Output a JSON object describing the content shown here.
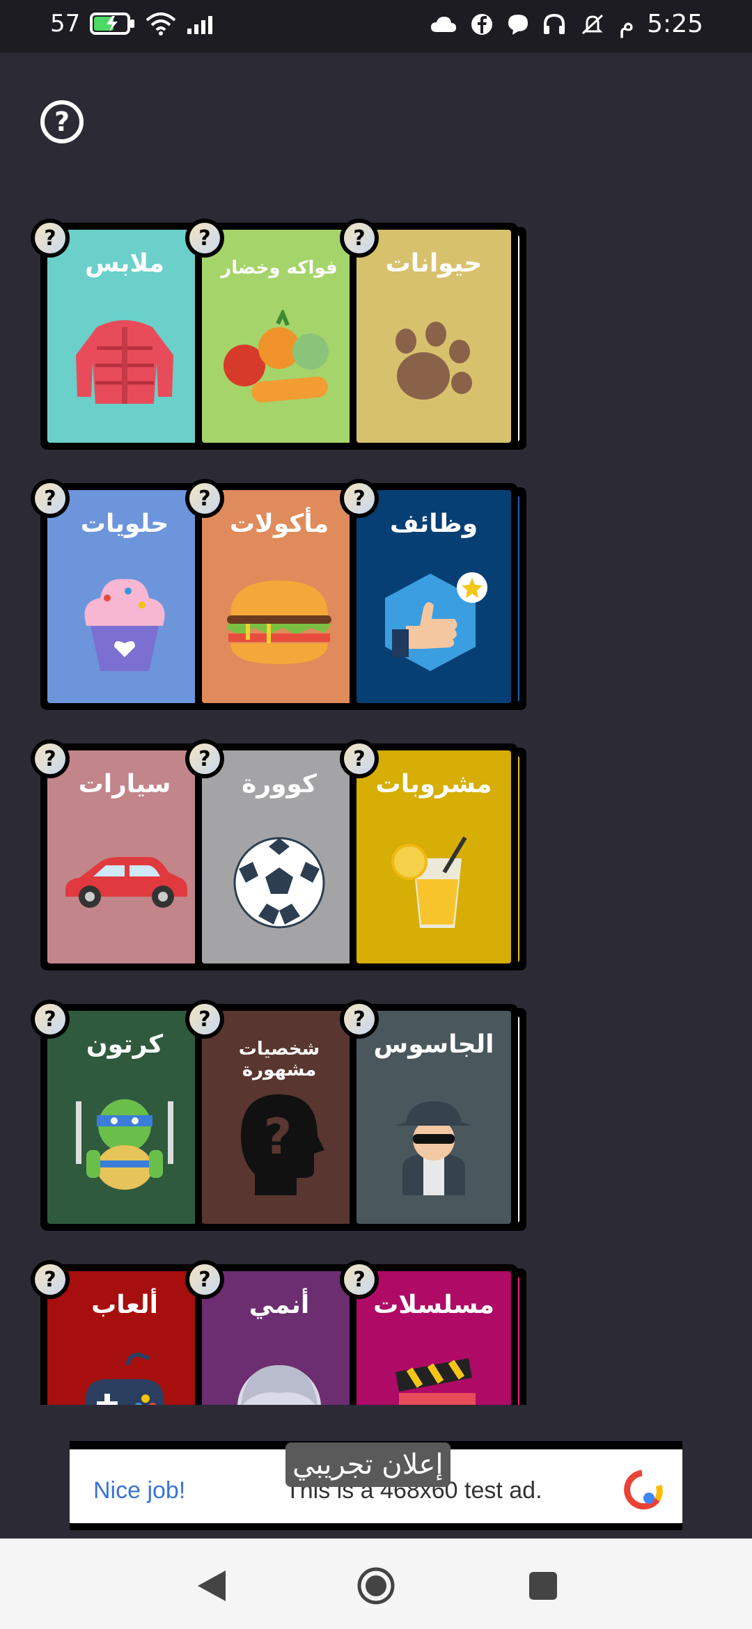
{
  "status_bar": {
    "time": "5:25",
    "period": "م",
    "battery_level": "57",
    "icons": [
      "signal-icon",
      "wifi-icon",
      "battery-icon",
      "cloud-icon",
      "facebook-icon",
      "chat-icon",
      "headset-icon",
      "dnd-icon"
    ]
  },
  "help": {
    "symbol": "?"
  },
  "categories": [
    {
      "label": "ملابس",
      "icon": "jacket-icon",
      "color": "#6bd0c9",
      "edge": "#ffffff"
    },
    {
      "label": "فواكه وخضار",
      "icon": "vegetables-icon",
      "color": "#a4d46a",
      "edge": "#ffffff"
    },
    {
      "label": "حيوانات",
      "icon": "paw-icon",
      "color": "#d8c16d",
      "edge": "#ffffff"
    },
    {
      "label": "حلويات",
      "icon": "cupcake-icon",
      "color": "#6d95dc",
      "edge": "#ffffff"
    },
    {
      "label": "مأكولات",
      "icon": "burger-icon",
      "color": "#e08b5b",
      "edge": "#ffffff"
    },
    {
      "label": "وظائف",
      "icon": "thumbs-up-icon",
      "color": "#063f74",
      "edge": "#1b63b0"
    },
    {
      "label": "سيارات",
      "icon": "car-icon",
      "color": "#c2858a",
      "edge": "#ffffff"
    },
    {
      "label": "كوورة",
      "icon": "football-icon",
      "color": "#a4a4a6",
      "edge": "#ffffff"
    },
    {
      "label": "مشروبات",
      "icon": "juice-icon",
      "color": "#d6ae05",
      "edge": "#f0c000"
    },
    {
      "label": "كرتون",
      "icon": "turtle-icon",
      "color": "#2f5a3e",
      "edge": "#ffffff"
    },
    {
      "label": "شخصيات مشهورة",
      "icon": "head-question-icon",
      "color": "#5a3630",
      "edge": "#ffffff"
    },
    {
      "label": "الجاسوس",
      "icon": "spy-icon",
      "color": "#4a575c",
      "edge": "#ffffff"
    },
    {
      "label": "ألعاب",
      "icon": "gamepad-icon",
      "color": "#a70e0e",
      "edge": "#e01010"
    },
    {
      "label": "أنمي",
      "icon": "anime-icon",
      "color": "#6c2d71",
      "edge": "#ffffff"
    },
    {
      "label": "مسلسلات",
      "icon": "clapperboard-icon",
      "color": "#ae0a66",
      "edge": "#ff1a8c"
    }
  ],
  "badge_symbol": "?",
  "ad": {
    "headline": "Nice job!",
    "body": "This is a 468x60 test ad.",
    "logo_icon": "ad-logo-icon"
  },
  "toast": "إعلان تجريبي",
  "nav": [
    "back-icon",
    "home-icon",
    "recents-icon"
  ]
}
